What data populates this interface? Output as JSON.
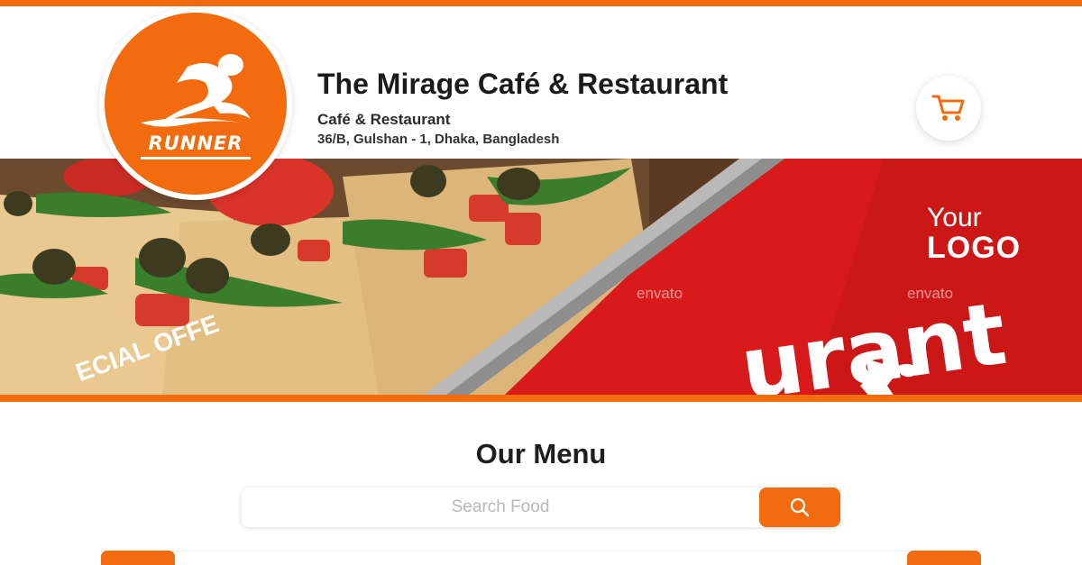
{
  "header": {
    "logo_text": "RUNNER",
    "title": "The Mirage Café & Restaurant",
    "subtitle": "Café & Restaurant",
    "address": "36/B, Gulshan - 1, Dhaka, Bangladesh",
    "cart_icon": "cart-icon"
  },
  "banner": {
    "logo_line1": "Your",
    "logo_line2": "LOGO",
    "watermark": "envato",
    "offer_text": "ECIAL OFFE",
    "big_word": "urant"
  },
  "menu": {
    "title": "Our Menu",
    "search_placeholder": "Search Food",
    "search_icon": "search-icon"
  },
  "colors": {
    "accent": "#f26b0f",
    "banner_red": "#d81a1a"
  }
}
